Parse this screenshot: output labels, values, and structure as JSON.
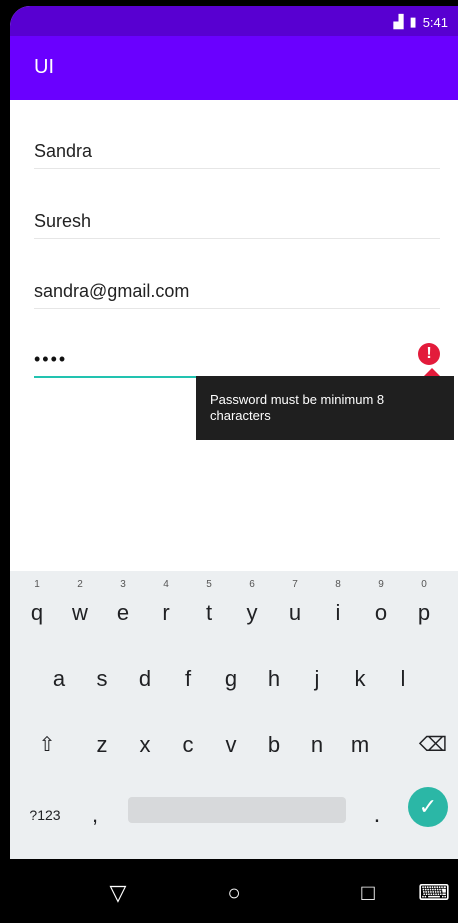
{
  "status": {
    "time": "5:41",
    "network_icon": "signal-icon",
    "battery_icon": "battery-icon"
  },
  "app": {
    "title": "UI"
  },
  "form": {
    "first_name": "Sandra",
    "last_name": "Suresh",
    "email": "sandra@gmail.com",
    "password_masked": "••••",
    "password_error": "Password must be minimum 8 characters"
  },
  "keyboard": {
    "row1": [
      {
        "key": "q",
        "hint": "1"
      },
      {
        "key": "w",
        "hint": "2"
      },
      {
        "key": "e",
        "hint": "3"
      },
      {
        "key": "r",
        "hint": "4"
      },
      {
        "key": "t",
        "hint": "5"
      },
      {
        "key": "y",
        "hint": "6"
      },
      {
        "key": "u",
        "hint": "7"
      },
      {
        "key": "i",
        "hint": "8"
      },
      {
        "key": "o",
        "hint": "9"
      },
      {
        "key": "p",
        "hint": "0"
      }
    ],
    "row2": [
      "a",
      "s",
      "d",
      "f",
      "g",
      "h",
      "j",
      "k",
      "l"
    ],
    "row3": [
      "z",
      "x",
      "c",
      "v",
      "b",
      "n",
      "m"
    ],
    "symbols_label": "?123",
    "comma": ",",
    "period": ".",
    "done_icon": "check-icon"
  },
  "colors": {
    "primary": "#6a00ff",
    "primary_dark": "#5800d1",
    "accent": "#22c3b0",
    "error": "#e31b3b"
  }
}
